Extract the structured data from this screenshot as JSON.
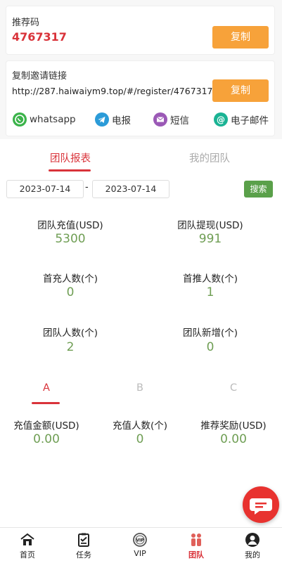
{
  "referral": {
    "label": "推荐码",
    "code": "4767317",
    "copy_label": "复制"
  },
  "invite": {
    "label": "复制邀请链接",
    "link": "http://287.haiwaiym9.top/#/register/4767317",
    "copy_label": "复制"
  },
  "share": [
    {
      "label": "whatsapp",
      "icon": "whatsapp-icon",
      "color": "#3bb34a"
    },
    {
      "label": "电报",
      "icon": "telegram-icon",
      "color": "#2b9bd8"
    },
    {
      "label": "短信",
      "icon": "sms-icon",
      "color": "#9b59b6"
    },
    {
      "label": "电子邮件",
      "icon": "email-icon",
      "color": "#1ab394"
    }
  ],
  "tabs": {
    "report": "团队报表",
    "my_team": "我的团队"
  },
  "filter": {
    "start_date": "2023-07-14",
    "separator": "-",
    "end_date": "2023-07-14",
    "search_label": "搜索"
  },
  "stats": {
    "recharge_label": "团队充值(USD)",
    "recharge_value": "5300",
    "withdraw_label": "团队提现(USD)",
    "withdraw_value": "991",
    "first_label": "首充人数(个)",
    "first_value": "0",
    "promote_label": "首推人数(个)",
    "promote_value": "1",
    "team_label": "团队人数(个)",
    "team_value": "2",
    "new_label": "团队新增(个)",
    "new_value": "0"
  },
  "levels": {
    "a": "A",
    "b": "B",
    "c": "C"
  },
  "level_stats": {
    "amount_label": "充值金额(USD)",
    "amount_value": "0.00",
    "count_label": "充值人数(个)",
    "count_value": "0",
    "reward_label": "推荐奖励(USD)",
    "reward_value": "0.00"
  },
  "nav": [
    {
      "label": "首页",
      "icon": "home-icon"
    },
    {
      "label": "任务",
      "icon": "task-icon"
    },
    {
      "label": "VIP",
      "icon": "vip-icon"
    },
    {
      "label": "团队",
      "icon": "team-icon"
    },
    {
      "label": "我的",
      "icon": "profile-icon"
    }
  ],
  "colors": {
    "accent_red": "#d9333a",
    "orange": "#f7a23a",
    "green": "#6f9e54",
    "search_green": "#5aa04a"
  }
}
